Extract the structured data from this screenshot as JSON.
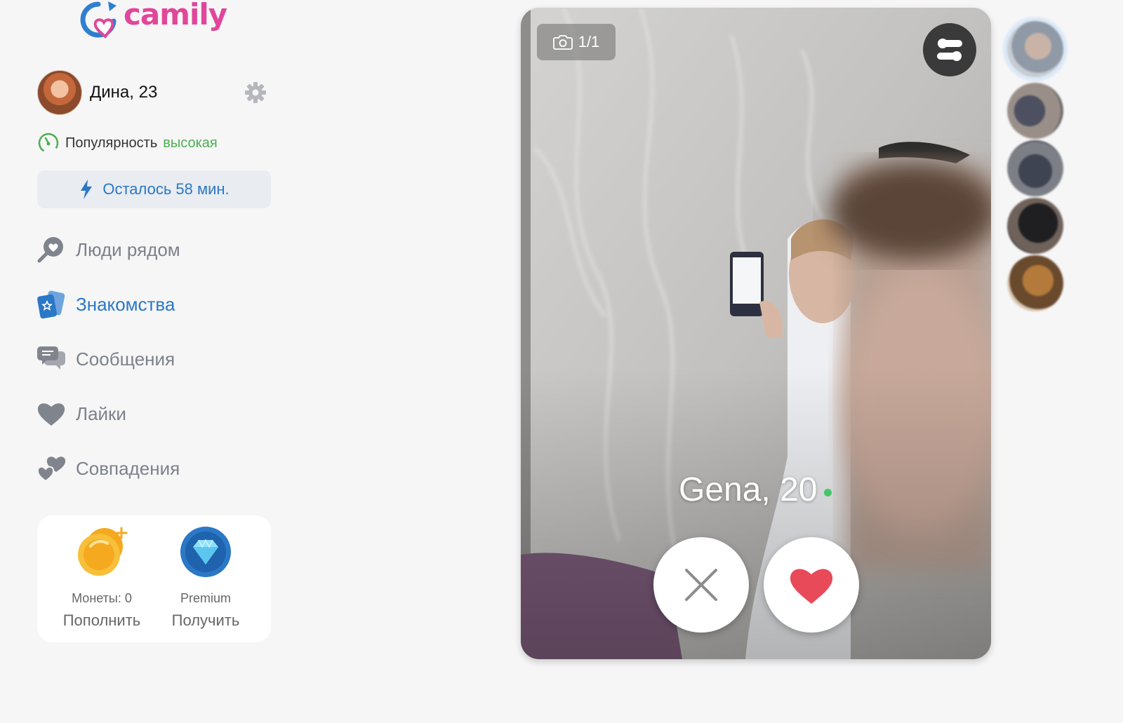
{
  "app": {
    "logo_text": "camily"
  },
  "profile": {
    "name_age": "Дина, 23"
  },
  "popularity": {
    "label": "Популярность",
    "value": "высокая",
    "value_color": "#4caf50"
  },
  "boost": {
    "label": "Осталось 58 мин."
  },
  "nav": {
    "items": [
      {
        "label": "Люди рядом",
        "icon": "location-heart-icon",
        "active": false
      },
      {
        "label": "Знакомства",
        "icon": "cards-icon",
        "active": true
      },
      {
        "label": "Сообщения",
        "icon": "chat-bubbles-icon",
        "active": false
      },
      {
        "label": "Лайки",
        "icon": "heart-icon",
        "active": false
      },
      {
        "label": "Совпадения",
        "icon": "two-hearts-icon",
        "active": false
      }
    ]
  },
  "wallet": {
    "coins": {
      "label": "Монеты: 0",
      "action": "Пополнить"
    },
    "premium": {
      "label": "Premium",
      "action": "Получить"
    }
  },
  "card": {
    "photo_counter": "1/1",
    "name_age": "Gena, 20",
    "online": true
  },
  "colors": {
    "accent": "#2b78c6",
    "brand": "#e0479a",
    "like": "#e94a5a"
  }
}
